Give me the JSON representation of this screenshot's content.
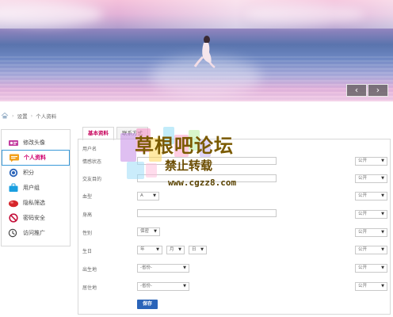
{
  "banner": {
    "prev_glyph": "‹",
    "next_glyph": "›"
  },
  "breadcrumb": {
    "items": [
      "设置",
      "个人资料"
    ],
    "separator": "›"
  },
  "sidebar": {
    "items": [
      {
        "label": "修改头像",
        "icon": "avatar-icon",
        "color": "#c23da0"
      },
      {
        "label": "个人资料",
        "icon": "profile-card-icon",
        "color": "#f2a01c",
        "active": true
      },
      {
        "label": "积分",
        "icon": "points-icon",
        "color": "#2a64b9"
      },
      {
        "label": "用户组",
        "icon": "group-icon",
        "color": "#1a9fe0"
      },
      {
        "label": "隐私筛选",
        "icon": "privacy-icon",
        "color": "#d6262b"
      },
      {
        "label": "密码安全",
        "icon": "password-icon",
        "color": "#c40f3a"
      },
      {
        "label": "访问推广",
        "icon": "promote-icon",
        "color": "#444444"
      }
    ]
  },
  "tabs": [
    "基本资料",
    "联系方式"
  ],
  "form": {
    "fields": [
      {
        "label": "用户名"
      },
      {
        "label": "情感状态",
        "privacy": "公开"
      },
      {
        "label": "交友目的",
        "privacy": "公开"
      },
      {
        "label": "血型",
        "value": "A",
        "privacy": "公开"
      },
      {
        "label": "身高",
        "privacy": "公开"
      },
      {
        "label": "性别",
        "value": "保密",
        "privacy": "公开"
      },
      {
        "label": "生日",
        "year": "年",
        "month": "月",
        "day": "日",
        "privacy": "公开"
      },
      {
        "label": "出生地",
        "value": "-省份-",
        "privacy": "公开"
      },
      {
        "label": "居住地",
        "value": "-省份-",
        "privacy": "公开"
      }
    ],
    "save_label": "保存"
  },
  "watermark": {
    "line1": "草根吧论坛",
    "line2": "禁止转载",
    "line3": "www.cgzz8.com"
  }
}
